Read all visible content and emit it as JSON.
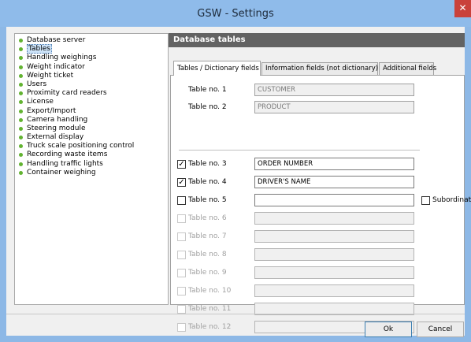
{
  "window": {
    "title": "GSW - Settings",
    "close_glyph": "✕"
  },
  "tree": {
    "items": [
      {
        "label": "Database server",
        "selected": false
      },
      {
        "label": "Tables",
        "selected": true
      },
      {
        "label": "Handling weighings",
        "selected": false
      },
      {
        "label": "Weight indicator",
        "selected": false
      },
      {
        "label": "Weight ticket",
        "selected": false
      },
      {
        "label": "Users",
        "selected": false
      },
      {
        "label": "Proximity card readers",
        "selected": false
      },
      {
        "label": "License",
        "selected": false
      },
      {
        "label": "Export/Import",
        "selected": false
      },
      {
        "label": "Camera handling",
        "selected": false
      },
      {
        "label": "Steering module",
        "selected": false
      },
      {
        "label": "External display",
        "selected": false
      },
      {
        "label": "Truck scale positioning control",
        "selected": false
      },
      {
        "label": "Recording waste items",
        "selected": false
      },
      {
        "label": "Handling traffic lights",
        "selected": false
      },
      {
        "label": "Container weighing",
        "selected": false
      }
    ]
  },
  "panel": {
    "header": "Database tables",
    "tabs": [
      {
        "label": "Tables / Dictionary fields",
        "active": true
      },
      {
        "label": "Information fields (not dictionary)",
        "active": false
      },
      {
        "label": "Additional fields",
        "active": false
      }
    ],
    "fixed_tables": [
      {
        "label": "Table no. 1",
        "value": "CUSTOMER"
      },
      {
        "label": "Table no. 2",
        "value": "PRODUCT"
      }
    ],
    "tables": [
      {
        "label": "Table no. 3",
        "value": "ORDER NUMBER",
        "checked": true,
        "enabled": true
      },
      {
        "label": "Table no. 4",
        "value": "DRIVER'S NAME",
        "checked": true,
        "enabled": true
      },
      {
        "label": "Table no. 5",
        "value": "",
        "checked": false,
        "enabled": true
      },
      {
        "label": "Table no. 6",
        "value": "",
        "checked": false,
        "enabled": false
      },
      {
        "label": "Table no. 7",
        "value": "",
        "checked": false,
        "enabled": false
      },
      {
        "label": "Table no. 8",
        "value": "",
        "checked": false,
        "enabled": false
      },
      {
        "label": "Table no. 9",
        "value": "",
        "checked": false,
        "enabled": false
      },
      {
        "label": "Table no. 10",
        "value": "",
        "checked": false,
        "enabled": false
      },
      {
        "label": "Table no. 11",
        "value": "",
        "checked": false,
        "enabled": false
      },
      {
        "label": "Table no. 12",
        "value": "",
        "checked": false,
        "enabled": false
      }
    ],
    "subordinate_label": "Subordinate",
    "checkmark": "✓"
  },
  "buttons": {
    "ok": "Ok",
    "cancel": "Cancel"
  },
  "colors": {
    "title_bar": "#8fbbea",
    "close": "#c9413b",
    "header": "#636363",
    "bullet": "#62b331"
  }
}
